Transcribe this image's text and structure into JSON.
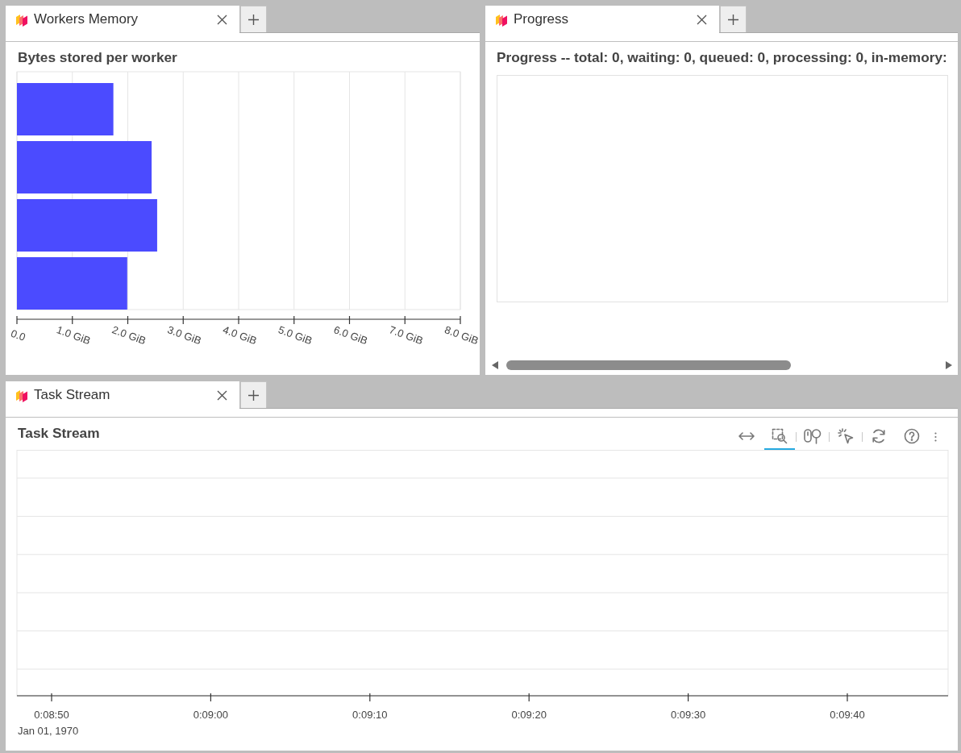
{
  "panels": [
    {
      "kind": "memory",
      "tabs": [
        {
          "label": "Workers Memory",
          "selected": true
        }
      ],
      "chart_data": {
        "type": "bar",
        "orientation": "horizontal",
        "title": "Bytes stored per worker",
        "values": [
          1.74,
          2.43,
          2.53,
          1.99
        ],
        "xlim": [
          0,
          8
        ],
        "xticks": [
          {
            "value": 0,
            "label": "0.0"
          },
          {
            "value": 1,
            "label": "1.0 GiB"
          },
          {
            "value": 2,
            "label": "2.0 GiB"
          },
          {
            "value": 3,
            "label": "3.0 GiB"
          },
          {
            "value": 4,
            "label": "4.0 GiB"
          },
          {
            "value": 5,
            "label": "5.0 GiB"
          },
          {
            "value": 6,
            "label": "6.0 GiB"
          },
          {
            "value": 7,
            "label": "7.0 GiB"
          },
          {
            "value": 8,
            "label": "8.0 GiB"
          }
        ],
        "grid": true
      }
    },
    {
      "kind": "progress",
      "tabs": [
        {
          "label": "Progress",
          "selected": true
        }
      ],
      "title": "Progress -- total: 0, waiting: 0, queued: 0, processing: 0, in-memory:"
    },
    {
      "kind": "task_stream",
      "tabs": [
        {
          "label": "Task Stream",
          "selected": true
        }
      ],
      "title": "Task Stream",
      "toolbar": {
        "groups": [
          {
            "tools": [
              {
                "kind": "pan",
                "selected": false
              },
              {
                "kind": "box_zoom",
                "selected": true
              }
            ]
          },
          {
            "tools": [
              {
                "kind": "wheel_zoom",
                "selected": false
              }
            ]
          },
          {
            "tools": [
              {
                "kind": "tap",
                "selected": false
              }
            ]
          },
          {
            "tools": [
              {
                "kind": "reset",
                "selected": false
              },
              {
                "kind": "help",
                "selected": false
              }
            ]
          }
        ]
      },
      "x_axis": {
        "tick_labels": [
          "0:08:50",
          "0:09:00",
          "0:09:10",
          "0:09:20",
          "0:09:30",
          "0:09:40"
        ],
        "date_label": "Jan 01, 1970"
      }
    }
  ]
}
